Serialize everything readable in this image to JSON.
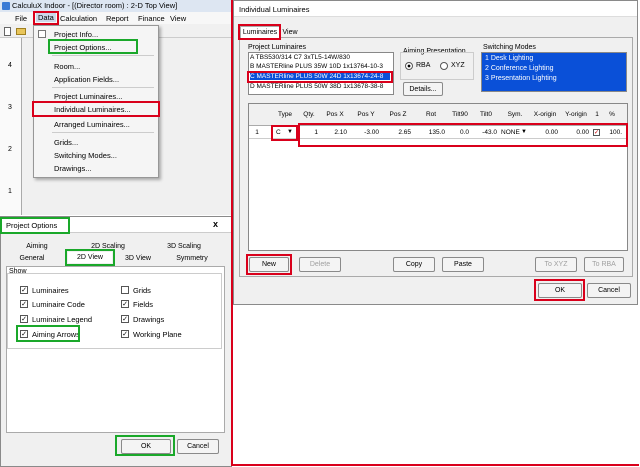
{
  "app": {
    "title": "CalculuX Indoor - [(Director room) : 2-D Top View]",
    "menubar": [
      "File",
      "Data",
      "Calculation",
      "Report",
      "Finance",
      "View"
    ]
  },
  "data_menu": {
    "items": [
      "Project Info...",
      "Project Options...",
      "Room...",
      "Application Fields...",
      "Project Luminaires...",
      "Individual Luminaires...",
      "Arranged Luminaires...",
      "Grids...",
      "Switching Modes...",
      "Drawings..."
    ]
  },
  "ruler": [
    "4",
    "3",
    "2",
    "1"
  ],
  "project_options": {
    "title": "Project Options",
    "close": "x",
    "tabs_row1": [
      "Aiming",
      "2D Scaling",
      "3D Scaling"
    ],
    "tabs_row2": [
      "General",
      "2D View",
      "3D View",
      "Symmetry"
    ],
    "show_label": "Show",
    "left_checks": [
      {
        "label": "Luminaires",
        "checked": true
      },
      {
        "label": "Luminaire Code",
        "checked": true
      },
      {
        "label": "Luminaire Legend",
        "checked": true
      },
      {
        "label": "Aiming Arrows",
        "checked": true
      }
    ],
    "right_checks": [
      {
        "label": "Grids",
        "checked": false
      },
      {
        "label": "Fields",
        "checked": true
      },
      {
        "label": "Drawings",
        "checked": true
      },
      {
        "label": "Working Plane",
        "checked": true
      }
    ],
    "ok": "OK",
    "cancel": "Cancel"
  },
  "individual_luminaires": {
    "title": "Individual Luminaires",
    "tabs": [
      "Luminaires",
      "View"
    ],
    "project_luminaires_label": "Project Luminaires",
    "luminaires": [
      "A  TBS530/314 C7 3xTL5-14W/830",
      "B  MASTERline PLUS 35W 10D 1x13764-10-3",
      "C  MASTERline PLUS 50W 24D 1x13674-24-8",
      "D  MASTERline PLUS 50W 38D 1x13678-38-8"
    ],
    "aiming_label": "Aiming Presentation",
    "aiming_options": [
      "RBA",
      "XYZ"
    ],
    "details": "Details...",
    "switching_label": "Switching Modes",
    "switching_modes": [
      "1  Desk Lighting",
      "2  Conference Lighting",
      "3  Presentation Lighting"
    ],
    "grid_headers": [
      "Type",
      "Qty.",
      "Pos X",
      "Pos Y",
      "Pos Z",
      "Rot",
      "Tilt90",
      "Tilt0",
      "Sym.",
      "X-origin",
      "Y-origin",
      "1",
      "%"
    ],
    "grid_row": {
      "num": "1",
      "type": "C",
      "qty": "1",
      "pos_x": "2.10",
      "pos_y": "-3.00",
      "pos_z": "2.65",
      "rot": "135.0",
      "tilt90": "0.0",
      "tilt0": "-43.0",
      "sym": "NONE",
      "x_origin": "0.00",
      "y_origin": "0.00",
      "pct": "100."
    },
    "buttons": [
      "New",
      "Delete",
      "Copy",
      "Paste",
      "To XYZ",
      "To RBA"
    ],
    "ok": "OK",
    "cancel": "Cancel"
  },
  "colors": {
    "highlight_red": "#d9001b",
    "highlight_green": "#1aa82a",
    "selection_blue": "#0a50d8"
  }
}
